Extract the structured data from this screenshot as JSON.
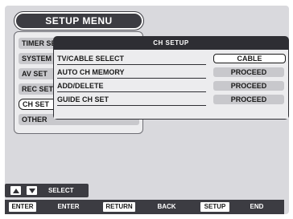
{
  "title": "SETUP MENU",
  "left_menu": {
    "items": [
      {
        "label": "TIMER SET"
      },
      {
        "label": "SYSTEM SET"
      },
      {
        "label": "AV SET"
      },
      {
        "label": "REC SET"
      },
      {
        "label": "CH SET"
      },
      {
        "label": "OTHER"
      }
    ],
    "selected_index": 4
  },
  "submenu": {
    "title": "CH SETUP",
    "rows": [
      {
        "label": "TV/CABLE SELECT",
        "value": "CABLE"
      },
      {
        "label": "AUTO CH MEMORY",
        "value": "PROCEED"
      },
      {
        "label": "ADD/DELETE",
        "value": "PROCEED"
      },
      {
        "label": "GUIDE CH SET",
        "value": "PROCEED"
      }
    ],
    "selected_index": 0
  },
  "navigation": {
    "label": "SELECT",
    "icons": [
      "arrow-up-icon",
      "arrow-down-icon"
    ]
  },
  "buttons": [
    {
      "key": "ENTER",
      "action": "ENTER"
    },
    {
      "key": "RETURN",
      "action": "BACK"
    },
    {
      "key": "SETUP",
      "action": "END"
    }
  ]
}
